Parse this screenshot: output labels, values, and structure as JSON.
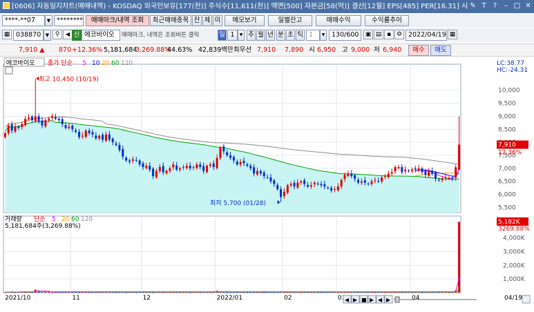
{
  "window": {
    "title": "[0606] 자동일지차트(매매내역) - KOSDAQ 외국인보유[177(천)] 주식수[11,611(천)] 액면[500] 자본금[58(억)] 결산[12월] EPS[485] PER[16.31] 시",
    "controls": [
      "✎",
      "T",
      "?",
      "–",
      "□",
      "✕"
    ]
  },
  "toolbar1": {
    "account": "****-**07",
    "password": "********",
    "tab_trade_mark": "매매마크/내역 조회",
    "tab_recent": "최근매매종목",
    "tab_jan": "잔",
    "tab_che": "체",
    "tab_mi": "미",
    "memo_btn": "메모보기",
    "daily_balance_btn": "일별잔고",
    "trade_profit_btn": "매매수익",
    "profit_trend_btn": "수익률추이"
  },
  "toolbar2": {
    "stock_code": "038870",
    "market_badge": "신",
    "stock_name": "에코바이오",
    "notice": "매매마크, 내역은 조회버튼 클릭",
    "periods": [
      "일",
      "1",
      "주",
      "월",
      "년",
      "분",
      "초",
      "틱"
    ],
    "active_period": "일",
    "count": "1",
    "range": "130/600",
    "date": "2022/04/19"
  },
  "quote": {
    "price": "7,910",
    "change": "870",
    "change_pct": "+12.36%",
    "volume": "5,181,684",
    "volume_ratio": "3,269.88%",
    "turnover": "44.63%",
    "value": "42,839백만",
    "best_offer_label": "최우선",
    "best_ask": "7,910",
    "best_bid": "7,890",
    "open_label": "시",
    "open": "6,950",
    "high_label": "고",
    "high": "9,000",
    "low_label": "저",
    "low": "6,940",
    "buy_btn": "매수",
    "sell_btn": "매도"
  },
  "price_panel": {
    "stock_label": "에코바이오",
    "ma_label": "종가 단순",
    "ma_periods": [
      "5",
      "10",
      "20",
      "60",
      "120"
    ],
    "ma_colors": [
      "#ff00ff",
      "#0000ff",
      "#ff9900",
      "#00a000",
      "#8c8c8c"
    ],
    "lc": "LC:38.77",
    "hc": "HC:-24.31",
    "current": "7,910",
    "current_pct": "12.36%",
    "max_annotation": "최고 10,450 (10/19)",
    "min_annotation": "최저 5,700 (01/28)"
  },
  "volume_panel": {
    "label": "거래량",
    "ma_label": "단순",
    "ma_periods": [
      "5",
      "20",
      "60",
      "120"
    ],
    "ma_colors": [
      "#ff00ff",
      "#ff9900",
      "#00a000",
      "#8c8c8c"
    ],
    "volume_text": "5,181,684주(3,269.88%)",
    "current": "5,182K",
    "current_pct": "3269.88%"
  },
  "x_axis": {
    "labels": [
      "2021/10",
      "11",
      "12",
      "2022/01",
      "02",
      "03",
      "04",
      "04/19"
    ]
  },
  "chart_data": [
    {
      "type": "candlestick",
      "title": "에코바이오",
      "ylim": [
        5300,
        11000
      ],
      "yticks": [
        "5,500",
        "6,000",
        "6,500",
        "7,000",
        "7,500",
        "8,000",
        "8,500",
        "9,000",
        "9,500",
        "10,000"
      ],
      "x": [
        "2021/10/01",
        "2021/10/05",
        "2021/10/06",
        "2021/10/07",
        "2021/10/08",
        "2021/10/12",
        "2021/10/13",
        "2021/10/14",
        "2021/10/15",
        "2021/10/18",
        "2021/10/19",
        "2021/10/20",
        "2021/10/21",
        "2021/10/22",
        "2021/10/25",
        "2021/10/26",
        "2021/10/27",
        "2021/10/28",
        "2021/10/29",
        "2021/11/01",
        "2021/11/02",
        "2021/11/03",
        "2021/11/04",
        "2021/11/05",
        "2021/11/08",
        "2021/11/09",
        "2021/11/10",
        "2021/11/11",
        "2021/11/12",
        "2021/11/15",
        "2021/11/16",
        "2021/11/17",
        "2021/11/18",
        "2021/11/19",
        "2021/11/22",
        "2021/11/23",
        "2021/11/24",
        "2021/11/25",
        "2021/11/26",
        "2021/11/29",
        "2021/11/30",
        "2021/12/01",
        "2021/12/02",
        "2021/12/03",
        "2021/12/06",
        "2021/12/07",
        "2021/12/08",
        "2021/12/09",
        "2021/12/10",
        "2021/12/13",
        "2021/12/14",
        "2021/12/15",
        "2021/12/16",
        "2021/12/17",
        "2021/12/20",
        "2021/12/21",
        "2021/12/22",
        "2021/12/23",
        "2021/12/24",
        "2021/12/27",
        "2021/12/28",
        "2021/12/29",
        "2021/12/30",
        "2022/01/03",
        "2022/01/04",
        "2022/01/05",
        "2022/01/06",
        "2022/01/07",
        "2022/01/10",
        "2022/01/11",
        "2022/01/12",
        "2022/01/13",
        "2022/01/14",
        "2022/01/17",
        "2022/01/18",
        "2022/01/19",
        "2022/01/20",
        "2022/01/21",
        "2022/01/24",
        "2022/01/25",
        "2022/01/26",
        "2022/01/27",
        "2022/01/28",
        "2022/02/03",
        "2022/02/04",
        "2022/02/07",
        "2022/02/08",
        "2022/02/09",
        "2022/02/10",
        "2022/02/11",
        "2022/02/14",
        "2022/02/15",
        "2022/02/16",
        "2022/02/17",
        "2022/02/18",
        "2022/02/21",
        "2022/02/22",
        "2022/02/23",
        "2022/02/24",
        "2022/02/25",
        "2022/02/28",
        "2022/03/02",
        "2022/03/03",
        "2022/03/04",
        "2022/03/07",
        "2022/03/08",
        "2022/03/10",
        "2022/03/11",
        "2022/03/14",
        "2022/03/15",
        "2022/03/16",
        "2022/03/17",
        "2022/03/18",
        "2022/03/21",
        "2022/03/22",
        "2022/03/23",
        "2022/03/24",
        "2022/03/25",
        "2022/03/28",
        "2022/03/29",
        "2022/03/30",
        "2022/03/31",
        "2022/04/01",
        "2022/04/04",
        "2022/04/05",
        "2022/04/06",
        "2022/04/07",
        "2022/04/08",
        "2022/04/11",
        "2022/04/12",
        "2022/04/13",
        "2022/04/14",
        "2022/04/15",
        "2022/04/18",
        "2022/04/19"
      ],
      "close": [
        8350,
        8650,
        8450,
        8600,
        8550,
        8700,
        8900,
        8950,
        8850,
        9000,
        8800,
        8650,
        8850,
        8900,
        9000,
        8900,
        8850,
        8700,
        8550,
        8600,
        8500,
        8400,
        8200,
        8250,
        8450,
        8350,
        8300,
        8150,
        8250,
        8100,
        8300,
        8100,
        8000,
        7900,
        7700,
        7450,
        7300,
        7250,
        7350,
        7300,
        7150,
        7050,
        7100,
        6950,
        6700,
        6900,
        7050,
        6850,
        6900,
        7000,
        7150,
        6950,
        7000,
        7050,
        7100,
        7000,
        7050,
        7150,
        7050,
        6900,
        7100,
        7150,
        7050,
        7400,
        7800,
        7650,
        7500,
        7400,
        7300,
        7150,
        7250,
        7200,
        7100,
        7000,
        6800,
        6900,
        6800,
        6700,
        6650,
        6500,
        6400,
        6200,
        5900,
        6100,
        6350,
        6400,
        6300,
        6450,
        6500,
        6400,
        6300,
        6350,
        6450,
        6400,
        6350,
        6300,
        6250,
        6150,
        6200,
        6300,
        6550,
        6750,
        6800,
        6700,
        6600,
        6450,
        6500,
        6450,
        6400,
        6500,
        6550,
        6500,
        6650,
        6700,
        6800,
        6850,
        7050,
        7050,
        6850,
        6950,
        6900,
        6950,
        6950,
        7000,
        6850,
        6750,
        6900,
        6800,
        6600,
        6550,
        6600,
        6650,
        6640,
        6600,
        7040,
        7910
      ]
    }
  ]
}
